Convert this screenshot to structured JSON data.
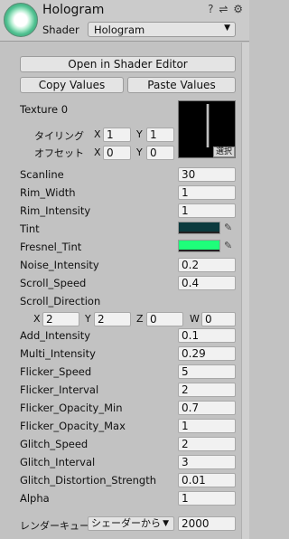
{
  "header": {
    "title": "Hologram",
    "icons": [
      "help-icon",
      "settings-sliders-icon",
      "gear-icon"
    ],
    "shader_label": "Shader",
    "shader_value": "Hologram"
  },
  "buttons": {
    "open_editor": "Open in Shader Editor",
    "copy": "Copy Values",
    "paste": "Paste Values"
  },
  "texture": {
    "label": "Texture 0",
    "tiling": "タイリング",
    "offset": "オフセット",
    "x": "X",
    "y": "Y",
    "tiling_x": "1",
    "tiling_y": "1",
    "offset_x": "0",
    "offset_y": "0",
    "select": "選択"
  },
  "props": {
    "scanline": {
      "label": "Scanline",
      "value": "30"
    },
    "rim_width": {
      "label": "Rim_Width",
      "value": "1"
    },
    "rim_intensity": {
      "label": "Rim_Intensity",
      "value": "1"
    },
    "tint": {
      "label": "Tint",
      "color": "#0b3a3e"
    },
    "fresnel_tint": {
      "label": "Fresnel_Tint",
      "color": "#1eff7a"
    },
    "noise_intensity": {
      "label": "Noise_Intensity",
      "value": "0.2"
    },
    "scroll_speed": {
      "label": "Scroll_Speed",
      "value": "0.4"
    },
    "scroll_direction": {
      "label": "Scroll_Direction",
      "x_label": "X",
      "y_label": "Y",
      "z_label": "Z",
      "w_label": "W",
      "x": "2",
      "y": "2",
      "z": "0",
      "w": "0"
    },
    "add_intensity": {
      "label": "Add_Intensity",
      "value": "0.1"
    },
    "multi_intensity": {
      "label": "Multi_Intensity",
      "value": "0.29"
    },
    "flicker_speed": {
      "label": "Flicker_Speed",
      "value": "5"
    },
    "flicker_interval": {
      "label": "Flicker_Interval",
      "value": "2"
    },
    "flicker_opacity_min": {
      "label": "Flicker_Opacity_Min",
      "value": "0.7"
    },
    "flicker_opacity_max": {
      "label": "Flicker_Opacity_Max",
      "value": "1"
    },
    "glitch_speed": {
      "label": "Glitch_Speed",
      "value": "2"
    },
    "glitch_interval": {
      "label": "Glitch_Interval",
      "value": "3"
    },
    "glitch_distortion_strength": {
      "label": "Glitch_Distortion_Strength",
      "value": "0.01"
    },
    "alpha": {
      "label": "Alpha",
      "value": "1"
    }
  },
  "render_queue": {
    "label": "レンダーキュー",
    "mode": "シェーダーから",
    "value": "2000"
  }
}
